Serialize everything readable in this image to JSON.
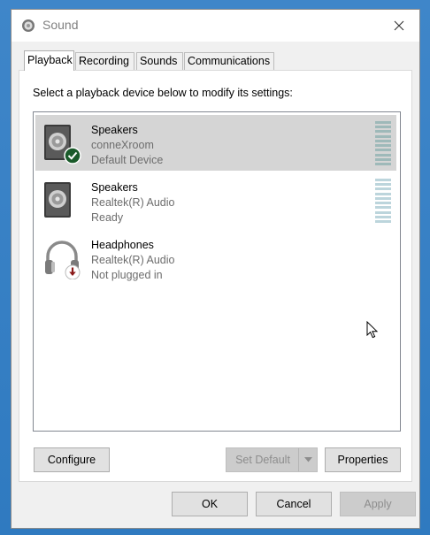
{
  "window": {
    "title": "Sound"
  },
  "tabs": [
    "Playback",
    "Recording",
    "Sounds",
    "Communications"
  ],
  "instruction": "Select a playback device below to modify its settings:",
  "devices": [
    {
      "name": "Speakers",
      "driver": "conneXroom",
      "status": "Default Device",
      "icon": "speaker-icon",
      "badge": "default-check-icon"
    },
    {
      "name": "Speakers",
      "driver": "Realtek(R) Audio",
      "status": "Ready",
      "icon": "speaker-icon",
      "badge": ""
    },
    {
      "name": "Headphones",
      "driver": "Realtek(R) Audio",
      "status": "Not plugged in",
      "icon": "headphones-icon",
      "badge": "unplugged-arrow-icon"
    }
  ],
  "buttons": {
    "configure": "Configure",
    "set_default": "Set Default",
    "properties": "Properties",
    "ok": "OK",
    "cancel": "Cancel",
    "apply": "Apply"
  },
  "colors": {
    "selected_row": "#d5d5d5",
    "check_badge": "#1a5a2a",
    "unplugged_badge": "#8b1a1a"
  }
}
